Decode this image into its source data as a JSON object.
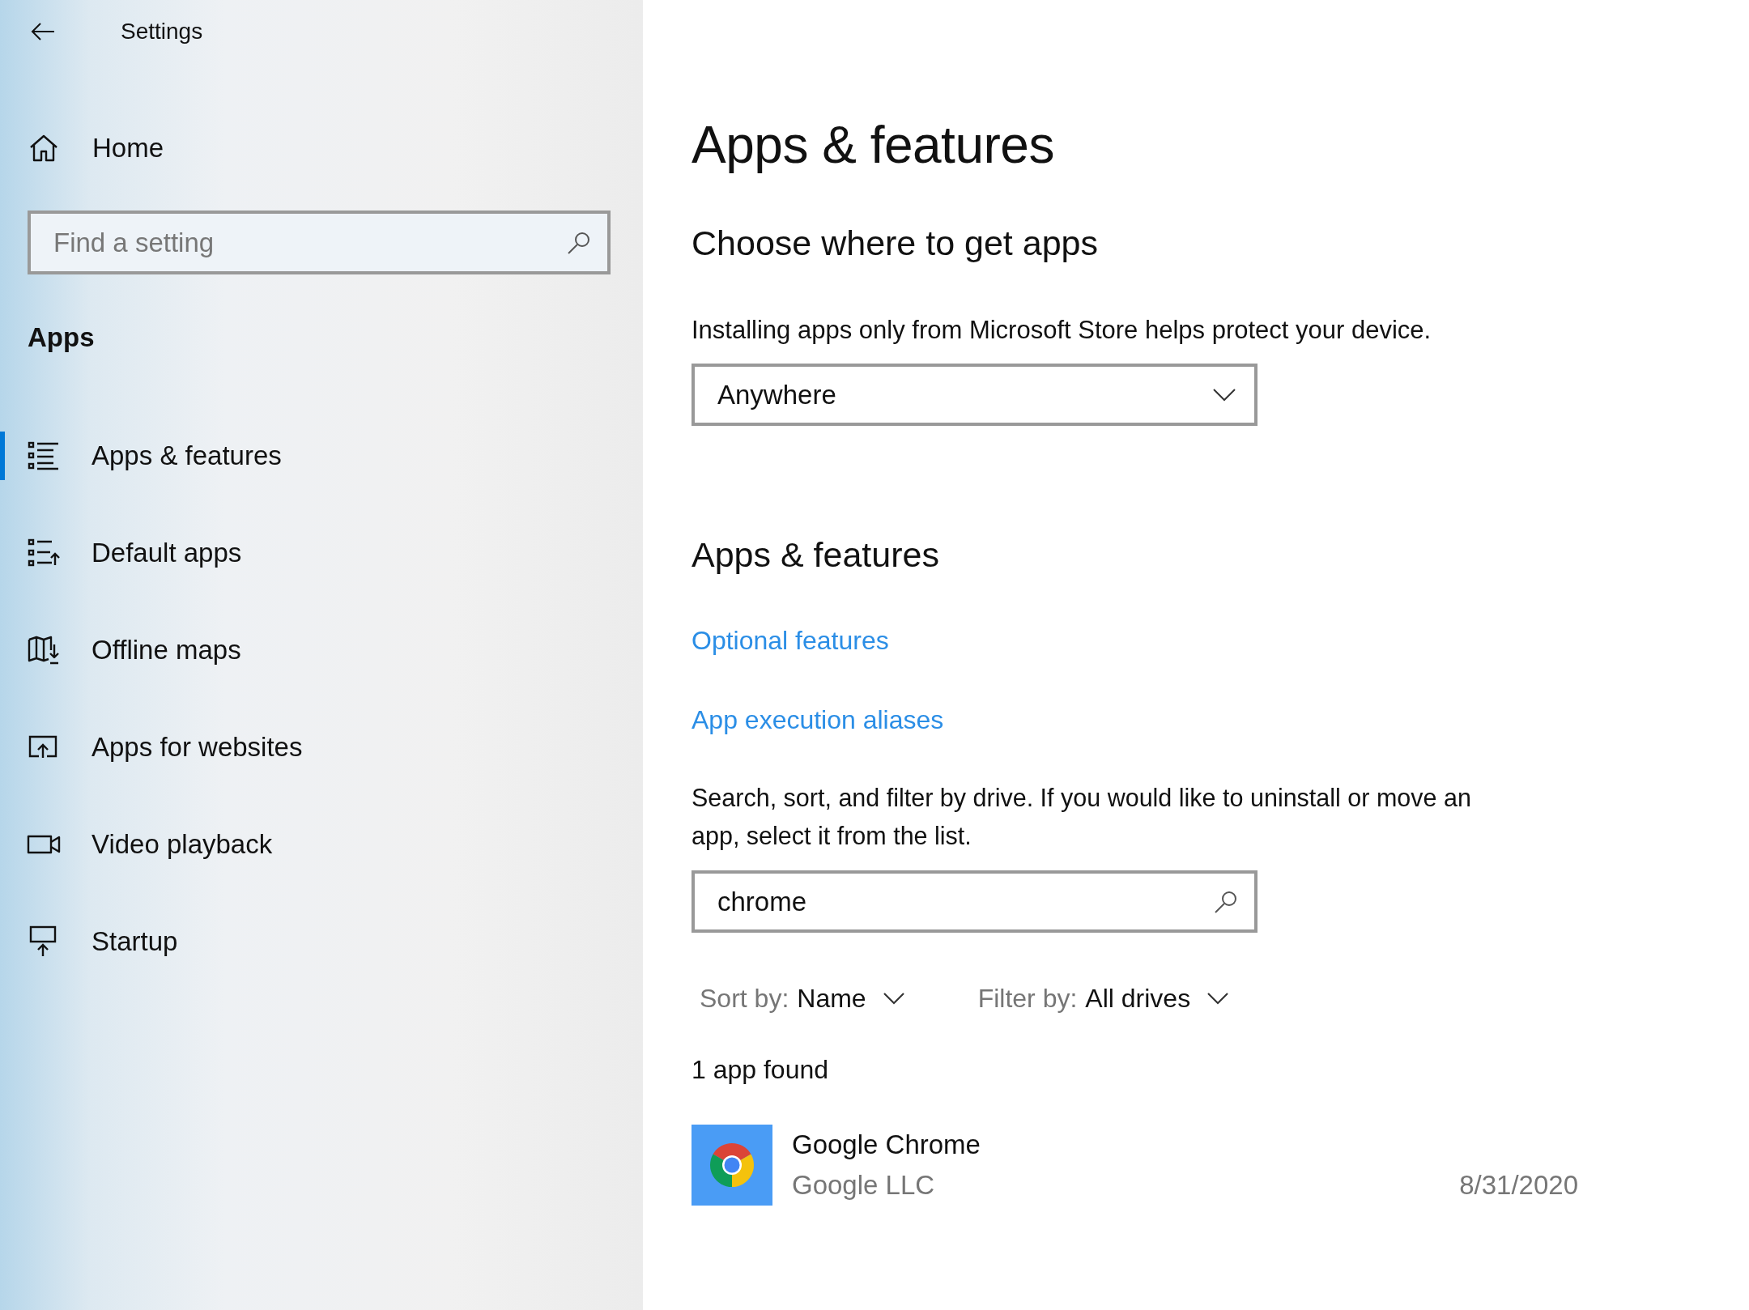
{
  "window": {
    "title": "Settings"
  },
  "sidebar": {
    "home": "Home",
    "search": {
      "placeholder": "Find a setting"
    },
    "section": "Apps",
    "items": [
      {
        "label": "Apps & features",
        "selected": true
      },
      {
        "label": "Default apps",
        "selected": false
      },
      {
        "label": "Offline maps",
        "selected": false
      },
      {
        "label": "Apps for websites",
        "selected": false
      },
      {
        "label": "Video playback",
        "selected": false
      },
      {
        "label": "Startup",
        "selected": false
      }
    ]
  },
  "main": {
    "title": "Apps & features",
    "choose": {
      "heading": "Choose where to get apps",
      "description": "Installing apps only from Microsoft Store helps protect your device.",
      "dropdown": {
        "value": "Anywhere"
      }
    },
    "apps": {
      "heading": "Apps & features",
      "links": [
        "Optional features",
        "App execution aliases"
      ],
      "description": "Search, sort, and filter by drive. If you would like to uninstall or move an app, select it from the list.",
      "search": {
        "value": "chrome"
      },
      "sort": {
        "label": "Sort by:",
        "value": "Name"
      },
      "filter": {
        "label": "Filter by:",
        "value": "All drives"
      },
      "count": "1 app found",
      "list": [
        {
          "name": "Google Chrome",
          "publisher": "Google LLC",
          "date": "8/31/2020"
        }
      ]
    }
  }
}
